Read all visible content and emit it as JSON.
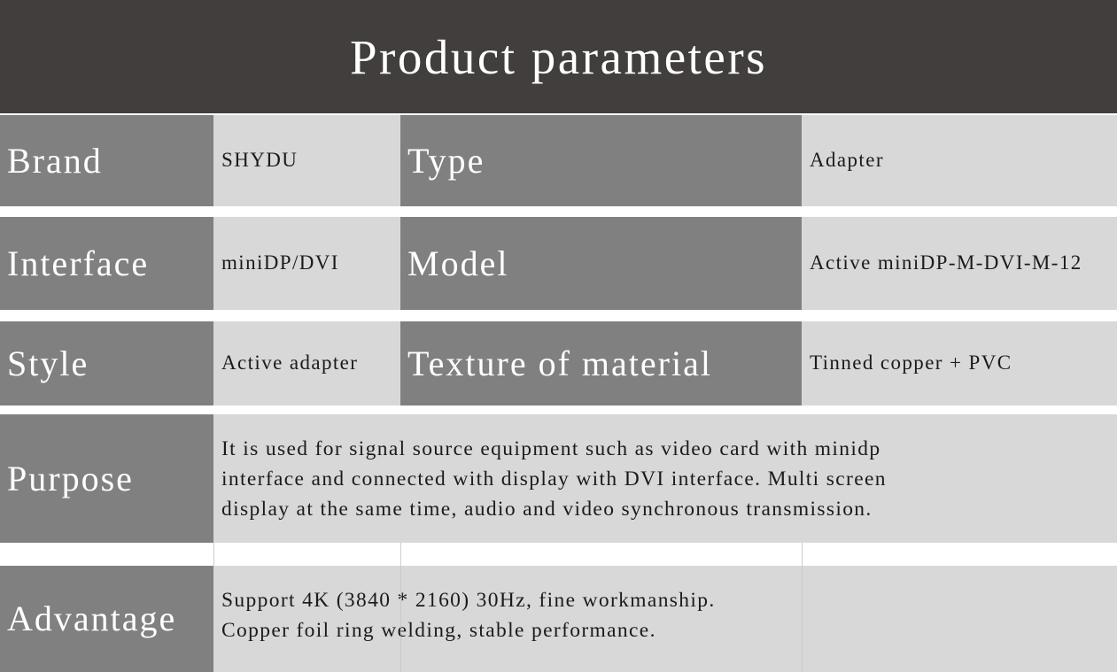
{
  "header": {
    "title": "Product parameters",
    "background": "#413e3d",
    "text_color": "#ffffff"
  },
  "colors": {
    "label_bg": "#808080",
    "value_bg": "#d8d8d8",
    "label_text": "#ffffff",
    "value_text": "#1b1b1b",
    "page_bg": "#ffffff"
  },
  "table": {
    "rows": [
      {
        "label_1": "Brand",
        "value_1": "SHYDU",
        "label_2": "Type",
        "value_2": "Adapter"
      },
      {
        "label_1": "Interface",
        "value_1": "miniDP/DVI",
        "label_2": "Model",
        "value_2": "Active miniDP-M-DVI-M-12"
      },
      {
        "label_1": "Style",
        "value_1": "Active adapter",
        "label_2": "Texture of material",
        "value_2": "Tinned copper + PVC"
      }
    ],
    "wide_rows": [
      {
        "label": "Purpose",
        "value": "It is used for signal source equipment such as video card with minidp\ninterface and connected with display with DVI interface. Multi screen\ndisplay at the same time, audio and video synchronous transmission."
      },
      {
        "label": "Advantage",
        "value": "Support 4K (3840 * 2160) 30Hz, fine workmanship.\nCopper foil ring welding, stable performance."
      }
    ]
  }
}
